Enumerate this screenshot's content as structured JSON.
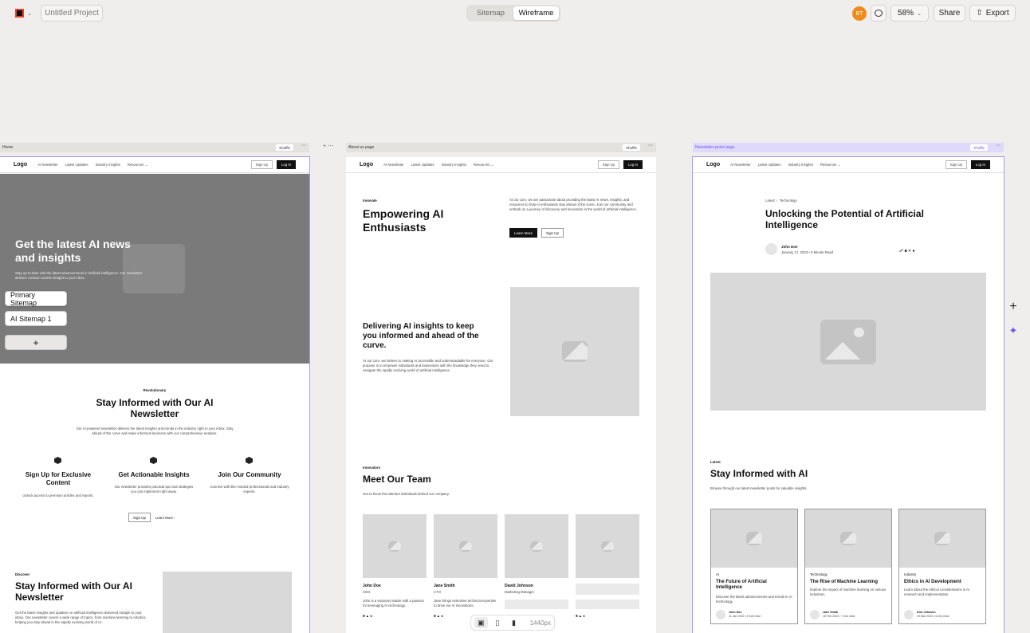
{
  "topbar": {
    "project_title": "Untitled Project",
    "view_tabs": [
      "Sitemap",
      "Wireframe"
    ],
    "active_tab": "Wireframe",
    "avatar_initials": "BT",
    "avatar_color": "#f08a1c",
    "zoom": "58%",
    "share_label": "Share",
    "export_label": "Export"
  },
  "sitemap_popover": {
    "primary_label": "Primary Sitemap",
    "secondary_label": "AI Sitemap 1",
    "add_symbol": "+"
  },
  "pages": {
    "home": {
      "name": "Home",
      "shuffle_label": "Shuffle",
      "nav": {
        "logo": "Logo",
        "links": [
          "AI Newsletter",
          "Latest Updates",
          "Industry Insights",
          "Resources"
        ],
        "signup": "Sign Up",
        "login": "Log In"
      },
      "hero": {
        "title": "Get the latest AI news and insights",
        "body": "Stay up-to-date with the latest advancements in artificial intelligence. Our newsletter delivers curated content straight to your inbox."
      },
      "newsletter": {
        "tag": "Revolutionary",
        "title": "Stay Informed with Our AI Newsletter",
        "body": "Our AI-powered newsletter delivers the latest insights and trends in the industry right to your inbox. Stay ahead of the curve and make informed decisions with our comprehensive analysis."
      },
      "features": [
        {
          "title": "Sign Up for Exclusive Content",
          "body": "Unlock access to premium articles and reports."
        },
        {
          "title": "Get Actionable Insights",
          "body": "Our newsletter provides practical tips and strategies you can implement right away."
        },
        {
          "title": "Join Our Community",
          "body": "Connect with like-minded professionals and industry experts."
        }
      ],
      "cta": {
        "signup": "Sign Up",
        "learn": "Learn More"
      },
      "discover": {
        "tag": "Discover",
        "title": "Stay Informed with Our AI Newsletter",
        "body": "Get the latest insights and updates on artificial intelligence delivered straight to your inbox. Our newsletter covers a wide range of topics, from machine learning to robotics, helping you stay ahead in the rapidly evolving world of AI."
      }
    },
    "about": {
      "name": "About us page",
      "shuffle_label": "Shuffle",
      "nav": {
        "logo": "Logo",
        "links": [
          "AI Newsletter",
          "Latest Updates",
          "Industry Insights",
          "Resources"
        ],
        "signup": "Sign Up",
        "login": "Log In"
      },
      "hero": {
        "tag": "Innovate",
        "title": "Empowering AI Enthusiasts",
        "body": "At our core, we are passionate about providing the latest AI news, insights, and resources to help AI enthusiasts stay ahead of the curve. Join our community and embark on a journey of discovery and innovation in the world of artificial intelligence.",
        "learn": "Learn More",
        "signup": "Sign Up"
      },
      "insights": {
        "title": "Delivering AI insights to keep you informed and ahead of the curve.",
        "body": "At our core, we believe in making AI accessible and understandable for everyone. Our purpose is to empower individuals and businesses with the knowledge they need to navigate the rapidly evolving world of artificial intelligence."
      },
      "team": {
        "tag": "Innovators",
        "title": "Meet Our Team",
        "body": "Get to know the talented individuals behind our company.",
        "members": [
          {
            "name": "John Doe",
            "role": "CEO",
            "bio": "John is a visionary leader with a passion for leveraging AI technology."
          },
          {
            "name": "Jane Smith",
            "role": "CTO",
            "bio": "Jane brings extensive technical expertise to drive our AI innovations."
          },
          {
            "name": "David Johnson",
            "role": "Marketing Manager",
            "bio": ""
          }
        ]
      }
    },
    "posts": {
      "name": "Newsletter posts page",
      "shuffle_label": "Shuffle",
      "nav": {
        "logo": "Logo",
        "links": [
          "AI Newsletter",
          "Latest Updates",
          "Industry Insights",
          "Resources"
        ],
        "signup": "Sign Up",
        "login": "Log In"
      },
      "article": {
        "crumb1": "Latest",
        "crumb2": "Technology",
        "title": "Unlocking the Potential of Artificial Intelligence",
        "author": "John Doe",
        "meta": "January 17, 2023 • 5 Minute Read"
      },
      "latest": {
        "tag": "Latest",
        "title": "Stay Informed with AI",
        "body": "Browse through our latest newsletter posts for valuable insights."
      },
      "cards": [
        {
          "tag": "AI",
          "title": "The Future of Artificial Intelligence",
          "body": "Discover the latest advancements and trends in AI technology.",
          "author": "John Doe",
          "meta": "11 Jan 2022 • 5 min read"
        },
        {
          "tag": "Technology",
          "title": "The Rise of Machine Learning",
          "body": "Explore the impact of machine learning on various industries.",
          "author": "Jane Smith",
          "meta": "15 Feb 2022 • 7 min read"
        },
        {
          "tag": "Industry",
          "title": "Ethics in AI Development",
          "body": "Learn about the ethical considerations in AI research and implementation.",
          "author": "Alex Johnson",
          "meta": "20 Mar 2022 • 6 min read"
        }
      ]
    }
  },
  "bottom_toolbar": {
    "width_label": "1440px"
  },
  "icons": [
    "logo-icon",
    "chevron-down-icon",
    "comment-icon",
    "export-icon",
    "plus-icon",
    "sparkle-icon",
    "laptop-icon",
    "tablet-icon",
    "phone-icon",
    "image-placeholder-icon",
    "cube-icon",
    "social-icons"
  ]
}
